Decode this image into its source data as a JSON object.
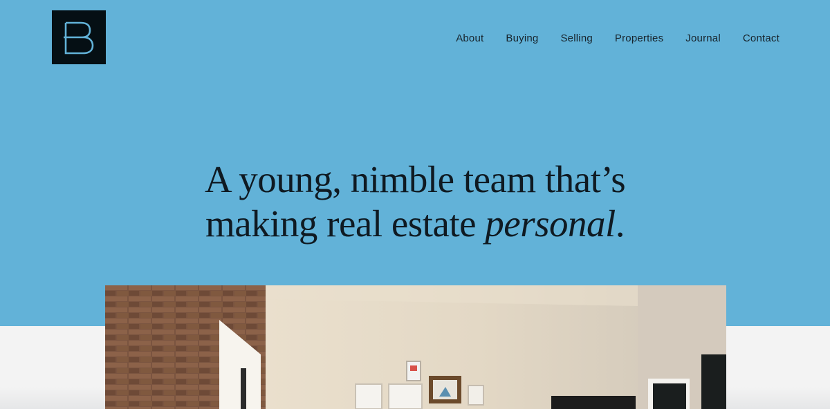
{
  "header": {
    "logo_letter": "B",
    "nav": [
      {
        "label": "About"
      },
      {
        "label": "Buying"
      },
      {
        "label": "Selling"
      },
      {
        "label": "Properties"
      },
      {
        "label": "Journal"
      },
      {
        "label": "Contact"
      }
    ]
  },
  "hero": {
    "line1": "A young, nimble team that’s",
    "line2_prefix": "making real estate ",
    "line2_emphasis": "personal",
    "line2_suffix": "."
  },
  "colors": {
    "hero_background": "#62b2d8",
    "logo_background": "#050f14",
    "logo_stroke": "#62b2d8",
    "text": "#0f1a22"
  },
  "icons": {
    "logo": "b-monogram-logo",
    "photo": "interior-room-photo"
  }
}
